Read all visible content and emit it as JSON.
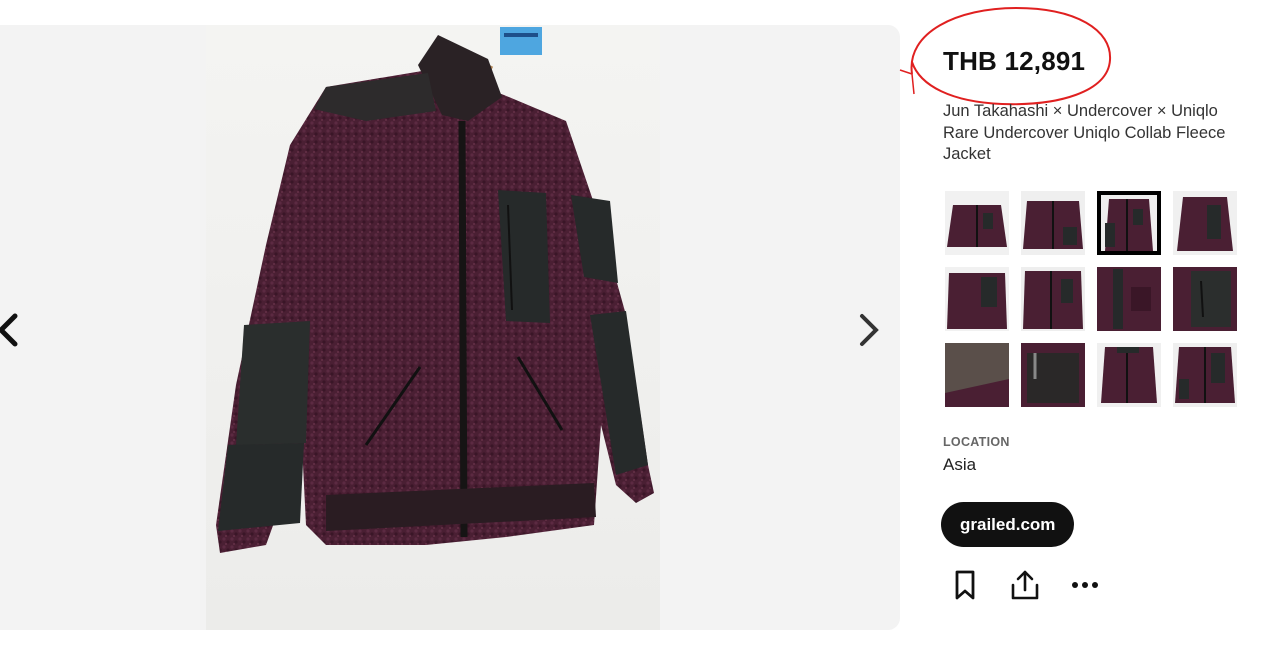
{
  "listing": {
    "price": "THB 12,891",
    "title": "Jun Takahashi × Undercover × Uniqlo Rare Undercover Uniqlo Collab Fleece Jacket",
    "location_label": "LOCATION",
    "location": "Asia",
    "source": "grailed.com"
  },
  "viewer": {
    "image_desc_icon": "fleece-jacket-photo",
    "prev_icon": "chevron-left-icon",
    "next_icon": "chevron-right-icon"
  },
  "thumbnails": {
    "count": 12,
    "active_index": 2
  },
  "actions": {
    "icons": [
      "bookmark-icon",
      "share-icon",
      "more-icon"
    ]
  },
  "colors": {
    "fleece": "#4a1f33",
    "nylon": "#26292a",
    "annotation": "#e02020",
    "pill": "#111111"
  }
}
